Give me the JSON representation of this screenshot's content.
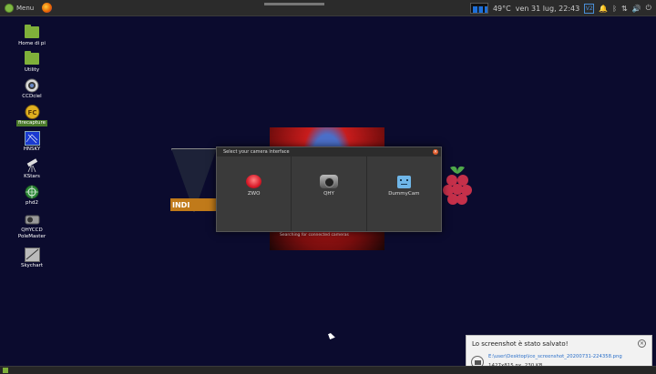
{
  "top_panel": {
    "menu_label": "Menu",
    "temperature": "49°C",
    "datetime": "ven 31 lug, 22:43",
    "vnc_label": "V2"
  },
  "desktop_icons": [
    {
      "label": "Home di pi"
    },
    {
      "label": "Utility"
    },
    {
      "label": "CCDciel"
    },
    {
      "label": "firecapture"
    },
    {
      "label": "HNSKY"
    },
    {
      "label": "KStars"
    },
    {
      "label": "phd2"
    },
    {
      "label": "QHYCCD PoleMaster"
    },
    {
      "label": "Skychart"
    }
  ],
  "background": {
    "indi_label": "INDI",
    "searching_text": "Searching for connected cameras"
  },
  "dialog": {
    "title": "Select your camera interface",
    "options": [
      {
        "label": "ZWO"
      },
      {
        "label": "QHY"
      },
      {
        "label": "DummyCam"
      }
    ]
  },
  "notification": {
    "title": "Lo screenshot è stato salvato!",
    "path": "E:\\user\\Desktop\\ice_screenshot_20200731-224358.png",
    "size": "1427x815 px, 230 KB"
  },
  "colors": {
    "desktop_bg": "#0b0b2e",
    "accent_green": "#7fb03a",
    "link_blue": "#2a6fc9"
  }
}
